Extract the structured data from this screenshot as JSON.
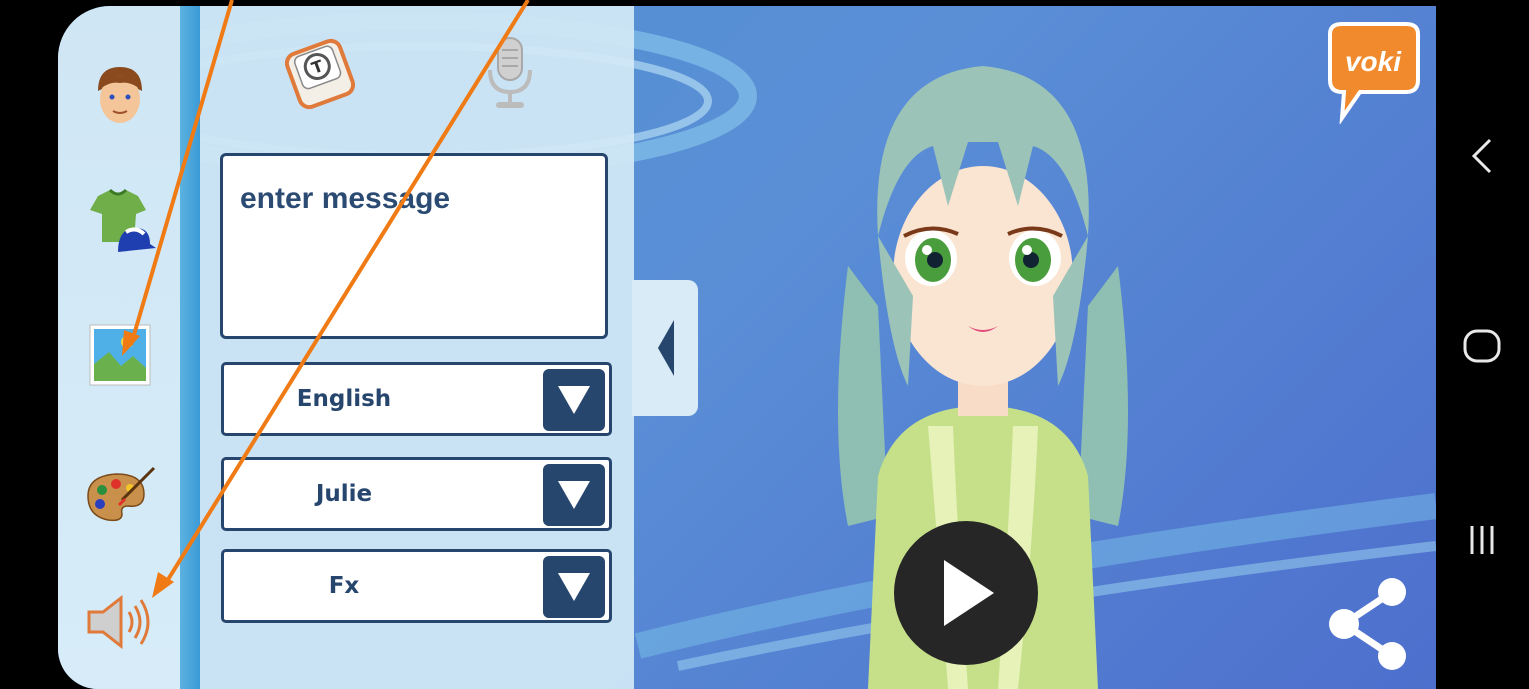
{
  "app": {
    "brand": "voki",
    "message_placeholder": "enter message",
    "language": {
      "label": "English"
    },
    "voice": {
      "label": "Julie"
    },
    "effects": {
      "label": "Fx"
    }
  },
  "rail": {
    "items": [
      {
        "icon": "face-icon",
        "label": "Character"
      },
      {
        "icon": "clothing-icon",
        "label": "Clothing"
      },
      {
        "icon": "background-image-icon",
        "label": "Background"
      },
      {
        "icon": "color-palette-icon",
        "label": "Colors"
      },
      {
        "icon": "speaker-icon",
        "label": "Voice"
      }
    ]
  },
  "modes": [
    {
      "icon": "text-keyboard-icon",
      "label": "Type"
    },
    {
      "icon": "microphone-icon",
      "label": "Record"
    }
  ],
  "colors": {
    "accent_dark": "#27466e",
    "annotation_arrow": "#f07a14",
    "logo": "#f08a2c"
  },
  "system_nav": [
    "back-icon",
    "home-icon",
    "recent-apps-icon"
  ]
}
